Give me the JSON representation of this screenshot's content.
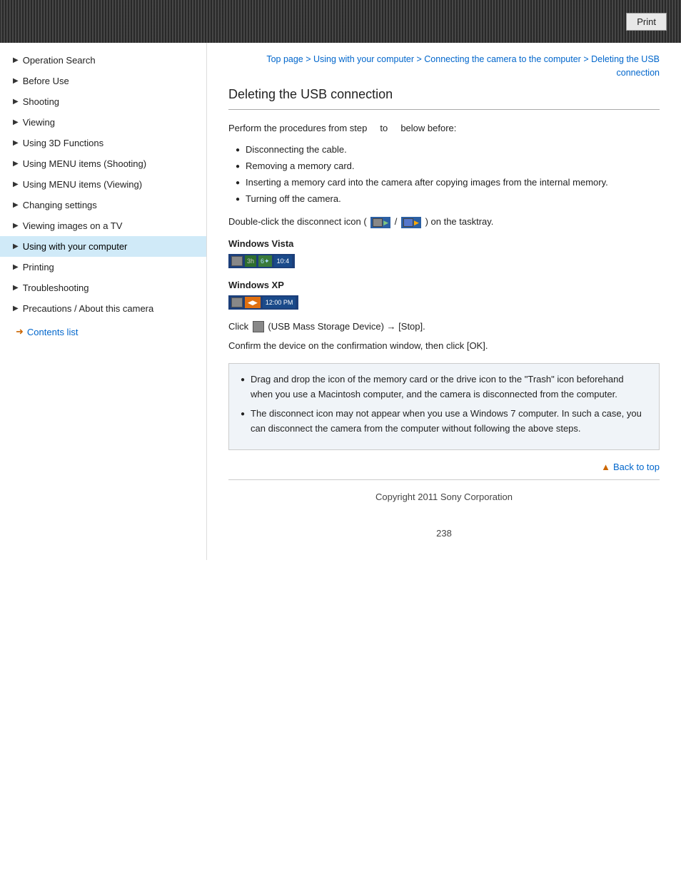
{
  "header": {
    "print_label": "Print"
  },
  "breadcrumb": {
    "top_page": "Top page",
    "separator1": " > ",
    "using_computer": "Using with your computer",
    "separator2": " > ",
    "connecting": "Connecting the camera to the computer",
    "separator3": " > ",
    "deleting": "Deleting the USB connection"
  },
  "sidebar": {
    "items": [
      {
        "id": "operation-search",
        "label": "Operation Search",
        "active": false
      },
      {
        "id": "before-use",
        "label": "Before Use",
        "active": false
      },
      {
        "id": "shooting",
        "label": "Shooting",
        "active": false
      },
      {
        "id": "viewing",
        "label": "Viewing",
        "active": false
      },
      {
        "id": "using-3d",
        "label": "Using 3D Functions",
        "active": false
      },
      {
        "id": "menu-shooting",
        "label": "Using MENU items (Shooting)",
        "active": false
      },
      {
        "id": "menu-viewing",
        "label": "Using MENU items (Viewing)",
        "active": false
      },
      {
        "id": "changing-settings",
        "label": "Changing settings",
        "active": false
      },
      {
        "id": "viewing-tv",
        "label": "Viewing images on a TV",
        "active": false
      },
      {
        "id": "using-computer",
        "label": "Using with your computer",
        "active": true
      },
      {
        "id": "printing",
        "label": "Printing",
        "active": false
      },
      {
        "id": "troubleshooting",
        "label": "Troubleshooting",
        "active": false
      },
      {
        "id": "precautions",
        "label": "Precautions / About this camera",
        "active": false
      }
    ],
    "contents_list_label": "Contents list"
  },
  "page": {
    "title": "Deleting the USB connection",
    "intro": "Perform the procedures from step    to    below before:",
    "bullets": [
      "Disconnecting the cable.",
      "Removing a memory card.",
      "Inserting a memory card into the camera after copying images from the internal memory.",
      "Turning off the camera."
    ],
    "double_click_text": "Double-click the disconnect icon (",
    "double_click_suffix": ") on the tasktray.",
    "vista_label": "Windows Vista",
    "xp_label": "Windows XP",
    "click_text": "Click",
    "click_suffix": "(USB Mass Storage Device) → [Stop].",
    "confirm_text": "Confirm the device on the confirmation window, then click [OK].",
    "notes": [
      "Drag and drop the icon of the memory card or the drive icon to the \"Trash\" icon beforehand when you use a Macintosh computer, and the camera is disconnected from the computer.",
      "The disconnect icon may not appear when you use a Windows 7 computer. In such a case, you can disconnect the camera from the computer without following the above steps."
    ],
    "back_to_top": "Back to top",
    "copyright": "Copyright 2011 Sony Corporation",
    "page_number": "238"
  }
}
